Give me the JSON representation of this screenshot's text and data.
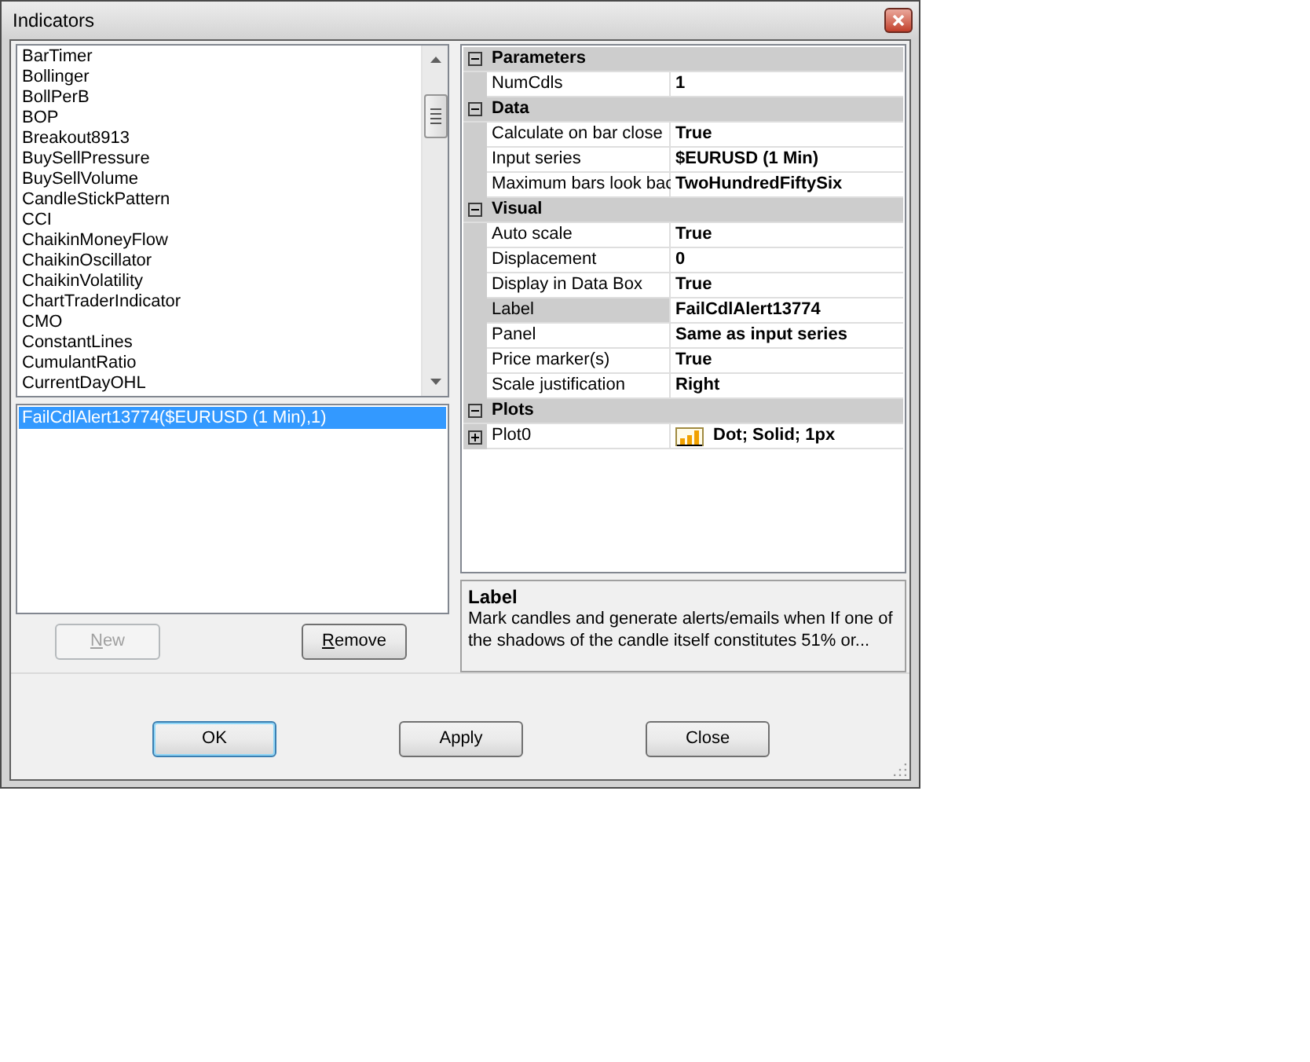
{
  "window": {
    "title": "Indicators"
  },
  "indicator_list": {
    "items": [
      {
        "label": "BarTimer",
        "selected": false
      },
      {
        "label": "Bollinger",
        "selected": false
      },
      {
        "label": "BollPerB",
        "selected": false
      },
      {
        "label": "BOP",
        "selected": false
      },
      {
        "label": "Breakout8913",
        "selected": false
      },
      {
        "label": "BuySellPressure",
        "selected": false
      },
      {
        "label": "BuySellVolume",
        "selected": false
      },
      {
        "label": "CandleStickPattern",
        "selected": false
      },
      {
        "label": "CCI",
        "selected": false
      },
      {
        "label": "ChaikinMoneyFlow",
        "selected": false
      },
      {
        "label": "ChaikinOscillator",
        "selected": false
      },
      {
        "label": "ChaikinVolatility",
        "selected": false
      },
      {
        "label": "ChartTraderIndicator",
        "selected": false
      },
      {
        "label": "CMO",
        "selected": false
      },
      {
        "label": "ConstantLines",
        "selected": false
      },
      {
        "label": "CumulantRatio",
        "selected": false
      },
      {
        "label": "CurrentDayOHL",
        "selected": false
      }
    ]
  },
  "applied_list": {
    "items": [
      {
        "label": "FailCdlAlert13774($EURUSD (1 Min),1)",
        "selected": true
      }
    ]
  },
  "list_buttons": [
    {
      "label": "New",
      "disabled": true
    },
    {
      "label": "Remove",
      "disabled": false
    }
  ],
  "properties": {
    "categories": [
      {
        "name": "Parameters",
        "expanded": true,
        "rows": [
          {
            "kind": "text",
            "name": "NumCdls",
            "value": "1",
            "selected": false
          }
        ]
      },
      {
        "name": "Data",
        "expanded": true,
        "rows": [
          {
            "kind": "text",
            "name": "Calculate on bar close",
            "value": "True",
            "selected": false
          },
          {
            "kind": "text",
            "name": "Input series",
            "value": "$EURUSD (1 Min)",
            "selected": false
          },
          {
            "kind": "text",
            "name": "Maximum bars look bac",
            "value": "TwoHundredFiftySix",
            "selected": false
          }
        ]
      },
      {
        "name": "Visual",
        "expanded": true,
        "rows": [
          {
            "kind": "text",
            "name": "Auto scale",
            "value": "True",
            "selected": false
          },
          {
            "kind": "text",
            "name": "Displacement",
            "value": "0",
            "selected": false
          },
          {
            "kind": "text",
            "name": "Display in Data Box",
            "value": "True",
            "selected": false
          },
          {
            "kind": "text",
            "name": "Label",
            "value": "FailCdlAlert13774",
            "selected": true
          },
          {
            "kind": "text",
            "name": "Panel",
            "value": "Same as input series",
            "selected": false
          },
          {
            "kind": "text",
            "name": "Price marker(s)",
            "value": "True",
            "selected": false
          },
          {
            "kind": "text",
            "name": "Scale justification",
            "value": "Right",
            "selected": false
          }
        ]
      },
      {
        "name": "Plots",
        "expanded": true,
        "rows": [
          {
            "kind": "plot",
            "name": "Plot0",
            "value": "Dot; Solid; 1px",
            "selected": false,
            "expanded": false
          }
        ]
      }
    ]
  },
  "description": {
    "title": "Label",
    "text": "Mark candles and generate alerts/emails when If one of the shadows of the candle itself constitutes 51% or..."
  },
  "buttons": [
    {
      "label": "OK",
      "default": true
    },
    {
      "label": "Apply",
      "default": false
    },
    {
      "label": "Close",
      "default": false
    }
  ]
}
